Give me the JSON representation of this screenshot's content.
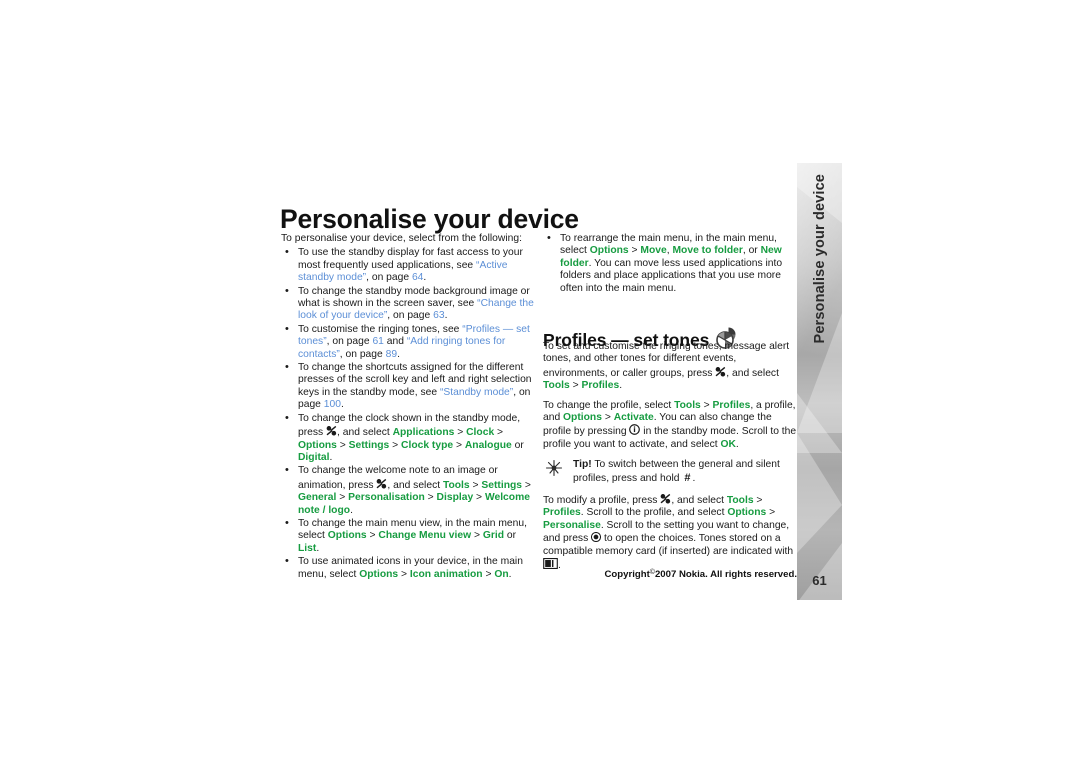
{
  "page_title": "Personalise your device",
  "side_tab": {
    "label": "Personalise your device",
    "page_number": "61"
  },
  "left_column": {
    "intro": "To personalise your device, select from the following:",
    "bullets": [
      {
        "id": "standby-display",
        "segments": [
          {
            "t": "To use the standby display for fast access to your most frequently used applications, see ",
            "s": "normal"
          },
          {
            "t": "“Active standby mode”",
            "s": "link"
          },
          {
            "t": ", on page ",
            "s": "normal"
          },
          {
            "t": "64",
            "s": "link"
          },
          {
            "t": ".",
            "s": "normal"
          }
        ]
      },
      {
        "id": "background-image",
        "segments": [
          {
            "t": "To change the standby mode background image or what is shown in the screen saver, see ",
            "s": "normal"
          },
          {
            "t": "“Change the look of your device”",
            "s": "link"
          },
          {
            "t": ", on page ",
            "s": "normal"
          },
          {
            "t": "63",
            "s": "link"
          },
          {
            "t": ".",
            "s": "normal"
          }
        ]
      },
      {
        "id": "ringing-tones",
        "segments": [
          {
            "t": "To customise the ringing tones, see ",
            "s": "normal"
          },
          {
            "t": "“Profiles — set tones”",
            "s": "link"
          },
          {
            "t": ", on page ",
            "s": "normal"
          },
          {
            "t": "61",
            "s": "link"
          },
          {
            "t": " and ",
            "s": "normal"
          },
          {
            "t": "“Add ringing tones for contacts”",
            "s": "link"
          },
          {
            "t": ", on page ",
            "s": "normal"
          },
          {
            "t": "89",
            "s": "link"
          },
          {
            "t": ".",
            "s": "normal"
          }
        ]
      },
      {
        "id": "shortcuts",
        "segments": [
          {
            "t": "To change the shortcuts assigned for the different presses of the scroll key and left and right selection keys in the standby mode, see ",
            "s": "normal"
          },
          {
            "t": "“Standby mode”",
            "s": "link"
          },
          {
            "t": ", on page ",
            "s": "normal"
          },
          {
            "t": "100",
            "s": "link"
          },
          {
            "t": ".",
            "s": "normal"
          }
        ]
      },
      {
        "id": "clock",
        "segments": [
          {
            "t": "To change the clock shown in the standby mode, press ",
            "s": "normal"
          },
          {
            "t": "",
            "s": "icon-menu"
          },
          {
            "t": ", and select ",
            "s": "normal"
          },
          {
            "t": "Applications",
            "s": "menu"
          },
          {
            "t": " > ",
            "s": "sep"
          },
          {
            "t": "Clock",
            "s": "menu"
          },
          {
            "t": " > ",
            "s": "sep"
          },
          {
            "t": "Options",
            "s": "menu"
          },
          {
            "t": " > ",
            "s": "sep"
          },
          {
            "t": "Settings",
            "s": "menu"
          },
          {
            "t": " > ",
            "s": "sep"
          },
          {
            "t": "Clock type",
            "s": "menu"
          },
          {
            "t": " > ",
            "s": "sep"
          },
          {
            "t": "Analogue",
            "s": "menu"
          },
          {
            "t": " or ",
            "s": "normal"
          },
          {
            "t": "Digital",
            "s": "menu"
          },
          {
            "t": ".",
            "s": "normal"
          }
        ]
      },
      {
        "id": "welcome-note",
        "segments": [
          {
            "t": "To change the welcome note to an image or animation, press ",
            "s": "normal"
          },
          {
            "t": "",
            "s": "icon-menu"
          },
          {
            "t": ", and select ",
            "s": "normal"
          },
          {
            "t": "Tools",
            "s": "menu"
          },
          {
            "t": " > ",
            "s": "sep"
          },
          {
            "t": "Settings",
            "s": "menu"
          },
          {
            "t": " > ",
            "s": "sep"
          },
          {
            "t": "General",
            "s": "menu"
          },
          {
            "t": " > ",
            "s": "sep"
          },
          {
            "t": "Personalisation",
            "s": "menu"
          },
          {
            "t": " > ",
            "s": "sep"
          },
          {
            "t": "Display",
            "s": "menu"
          },
          {
            "t": " > ",
            "s": "sep"
          },
          {
            "t": "Welcome note / logo",
            "s": "menu"
          },
          {
            "t": ".",
            "s": "normal"
          }
        ]
      },
      {
        "id": "main-menu-view",
        "segments": [
          {
            "t": "To change the main menu view, in the main menu, select ",
            "s": "normal"
          },
          {
            "t": "Options",
            "s": "menu"
          },
          {
            "t": " > ",
            "s": "sep"
          },
          {
            "t": "Change Menu view",
            "s": "menu"
          },
          {
            "t": " > ",
            "s": "sep"
          },
          {
            "t": "Grid",
            "s": "menu"
          },
          {
            "t": " or ",
            "s": "normal"
          },
          {
            "t": "List",
            "s": "menu"
          },
          {
            "t": ".",
            "s": "normal"
          }
        ]
      },
      {
        "id": "icon-animation",
        "segments": [
          {
            "t": "To use animated icons in your device, in the main menu, select ",
            "s": "normal"
          },
          {
            "t": "Options",
            "s": "menu"
          },
          {
            "t": " > ",
            "s": "sep"
          },
          {
            "t": "Icon animation",
            "s": "menu"
          },
          {
            "t": " > ",
            "s": "sep"
          },
          {
            "t": "On",
            "s": "menu"
          },
          {
            "t": ".",
            "s": "normal"
          }
        ]
      }
    ]
  },
  "right_column": {
    "bullets": [
      {
        "id": "rearrange-main-menu",
        "segments": [
          {
            "t": "To rearrange the main menu, in the main menu, select ",
            "s": "normal"
          },
          {
            "t": "Options",
            "s": "menu"
          },
          {
            "t": " > ",
            "s": "sep"
          },
          {
            "t": "Move",
            "s": "menu"
          },
          {
            "t": ", ",
            "s": "normal"
          },
          {
            "t": "Move to folder",
            "s": "menu"
          },
          {
            "t": ", or ",
            "s": "normal"
          },
          {
            "t": "New folder",
            "s": "menu"
          },
          {
            "t": ". You can move less used applications into folders and place applications that you use more often into the main menu.",
            "s": "normal"
          }
        ]
      }
    ],
    "section_heading": "Profiles — set tones",
    "section_icon": "profiles-icon",
    "paragraphs": [
      {
        "id": "set-customise-tones",
        "segments": [
          {
            "t": "To set and customise the ringing tones, message alert tones, and other tones for different events, environments, or caller groups, press ",
            "s": "normal"
          },
          {
            "t": "",
            "s": "icon-menu"
          },
          {
            "t": ", and select ",
            "s": "normal"
          },
          {
            "t": "Tools",
            "s": "menu"
          },
          {
            "t": " > ",
            "s": "sep"
          },
          {
            "t": "Profiles",
            "s": "menu"
          },
          {
            "t": ".",
            "s": "normal"
          }
        ]
      },
      {
        "id": "change-profile",
        "segments": [
          {
            "t": "To change the profile, select ",
            "s": "normal"
          },
          {
            "t": "Tools",
            "s": "menu"
          },
          {
            "t": " > ",
            "s": "sep"
          },
          {
            "t": "Profiles",
            "s": "menu"
          },
          {
            "t": ", a profile, and ",
            "s": "normal"
          },
          {
            "t": "Options",
            "s": "menu"
          },
          {
            "t": " > ",
            "s": "sep"
          },
          {
            "t": "Activate",
            "s": "menu"
          },
          {
            "t": ". You can also change the profile by pressing ",
            "s": "normal"
          },
          {
            "t": "",
            "s": "icon-info"
          },
          {
            "t": " in the standby mode. Scroll to the profile you want to activate, and select ",
            "s": "normal"
          },
          {
            "t": "OK",
            "s": "menu"
          },
          {
            "t": ".",
            "s": "normal"
          }
        ]
      }
    ],
    "tip": {
      "label": "Tip!",
      "segments": [
        {
          "t": " To switch between the general and silent profiles, press and hold ",
          "s": "normal"
        },
        {
          "t": "#",
          "s": "key"
        },
        {
          "t": ".",
          "s": "normal"
        }
      ]
    },
    "paragraphs_after_tip": [
      {
        "id": "modify-profile",
        "segments": [
          {
            "t": "To modify a profile, press ",
            "s": "normal"
          },
          {
            "t": "",
            "s": "icon-menu"
          },
          {
            "t": ", and select ",
            "s": "normal"
          },
          {
            "t": "Tools",
            "s": "menu"
          },
          {
            "t": " > ",
            "s": "sep"
          },
          {
            "t": "Profiles",
            "s": "menu"
          },
          {
            "t": ". Scroll to the profile, and select ",
            "s": "normal"
          },
          {
            "t": "Options",
            "s": "menu"
          },
          {
            "t": " > ",
            "s": "sep"
          },
          {
            "t": "Personalise",
            "s": "menu"
          },
          {
            "t": ". Scroll to the setting you want to change, and press ",
            "s": "normal"
          },
          {
            "t": "",
            "s": "icon-scroll"
          },
          {
            "t": " to open the choices. Tones stored on a compatible memory card (if inserted) are indicated with ",
            "s": "normal"
          },
          {
            "t": "",
            "s": "icon-card"
          },
          {
            "t": ".",
            "s": "normal"
          }
        ]
      }
    ]
  },
  "footer": {
    "copyright_prefix": "Copyright",
    "copyright_symbol": "©",
    "copyright_text": "2007 Nokia. All rights reserved.",
    "page_number": "61"
  },
  "colors": {
    "menu_green": "#179c41",
    "link_blue": "#5c8fd6",
    "text": "#1a1a1a",
    "tab_gray": "#b0b0b0"
  }
}
